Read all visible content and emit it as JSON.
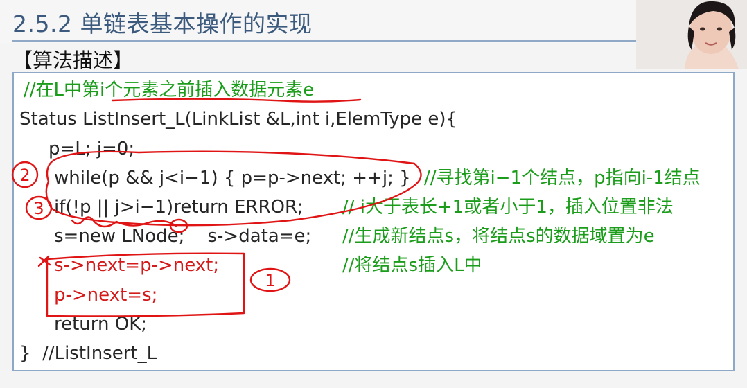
{
  "slide": {
    "title": "2.5.2 单链表基本操作的实现",
    "section": "【算法描述】"
  },
  "code": {
    "comment_header": "//在L中第i个元素之前插入数据元素e",
    "signature": "Status ListInsert_L(LinkList &L,int i,ElemType e){",
    "init": "p=L; j=0;",
    "while_line": "while(p && j<i−1) { p=p->next; ++j; }",
    "while_comment": "//寻找第i−1个结点，p指向i-1结点",
    "if_line": "if(!p || j>i−1)return ERROR;",
    "if_comment": "// i大于表长+1或者小于1，插入位置非法",
    "new_line": "s=new LNode;    s->data=e;",
    "new_comment": "//生成新结点s，将结点s的数据域置为e",
    "link1": "s->next=p->next;",
    "link1_comment": "//将结点s插入L中",
    "link2": "p->next=s;",
    "return_line": "return OK;",
    "end_line": "}  //ListInsert_L"
  },
  "annotations": {
    "mark_1": "1",
    "mark_2": "2",
    "mark_3": "3",
    "ink_color": "#e01414"
  }
}
